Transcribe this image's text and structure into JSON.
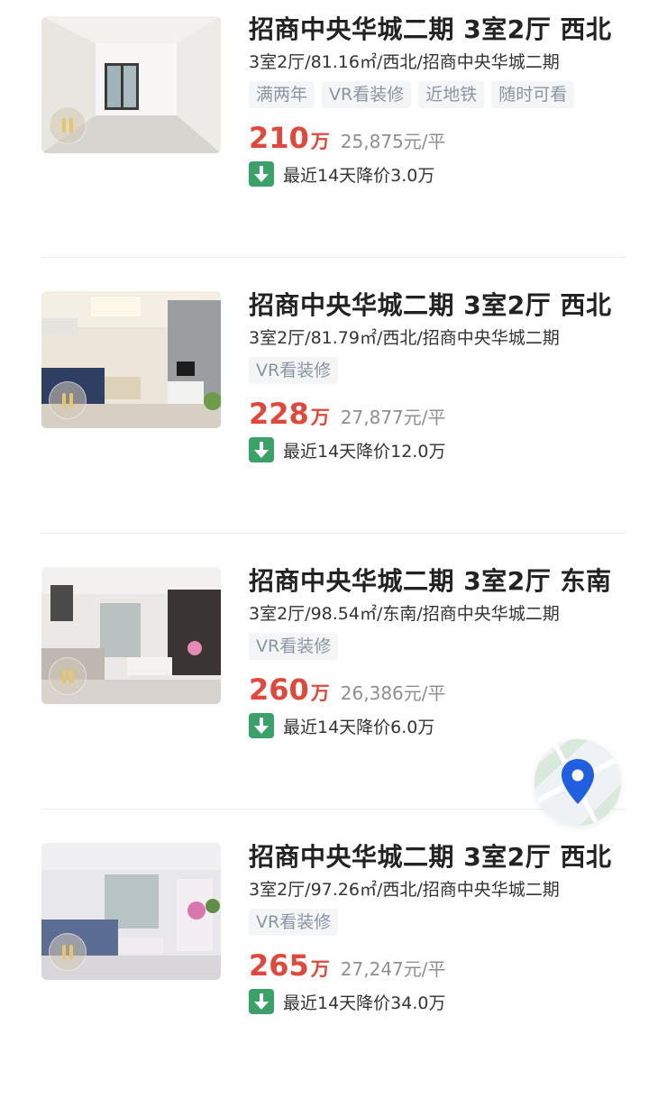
{
  "listings": [
    {
      "title": "招商中央华城二期 3室2厅 西北",
      "meta": "3室2厅/81.16㎡/西北/招商中央华城二期",
      "tags": [
        "满两年",
        "VR看装修",
        "近地铁",
        "随时可看"
      ],
      "total": "210",
      "unit": "万",
      "per": "25,875元/平",
      "drop": "最近14天降价3.0万"
    },
    {
      "title": "招商中央华城二期 3室2厅 西北",
      "meta": "3室2厅/81.79㎡/西北/招商中央华城二期",
      "tags": [
        "VR看装修"
      ],
      "total": "228",
      "unit": "万",
      "per": "27,877元/平",
      "drop": "最近14天降价12.0万"
    },
    {
      "title": "招商中央华城二期 3室2厅 东南",
      "meta": "3室2厅/98.54㎡/东南/招商中央华城二期",
      "tags": [
        "VR看装修"
      ],
      "total": "260",
      "unit": "万",
      "per": "26,386元/平",
      "drop": "最近14天降价6.0万"
    },
    {
      "title": "招商中央华城二期 3室2厅 西北",
      "meta": "3室2厅/97.26㎡/西北/招商中央华城二期",
      "tags": [
        "VR看装修"
      ],
      "total": "265",
      "unit": "万",
      "per": "27,247元/平",
      "drop": "最近14天降价34.0万"
    }
  ],
  "colors": {
    "price": "#e0483b",
    "drop": "#3aa169",
    "tag_bg": "#f3f5f7",
    "tag_text": "#8a95a3",
    "pin": "#1f5fe0"
  },
  "icons": {
    "drop": "down-arrow-icon",
    "map": "map-pin-icon",
    "vr": "vr-play-icon"
  }
}
